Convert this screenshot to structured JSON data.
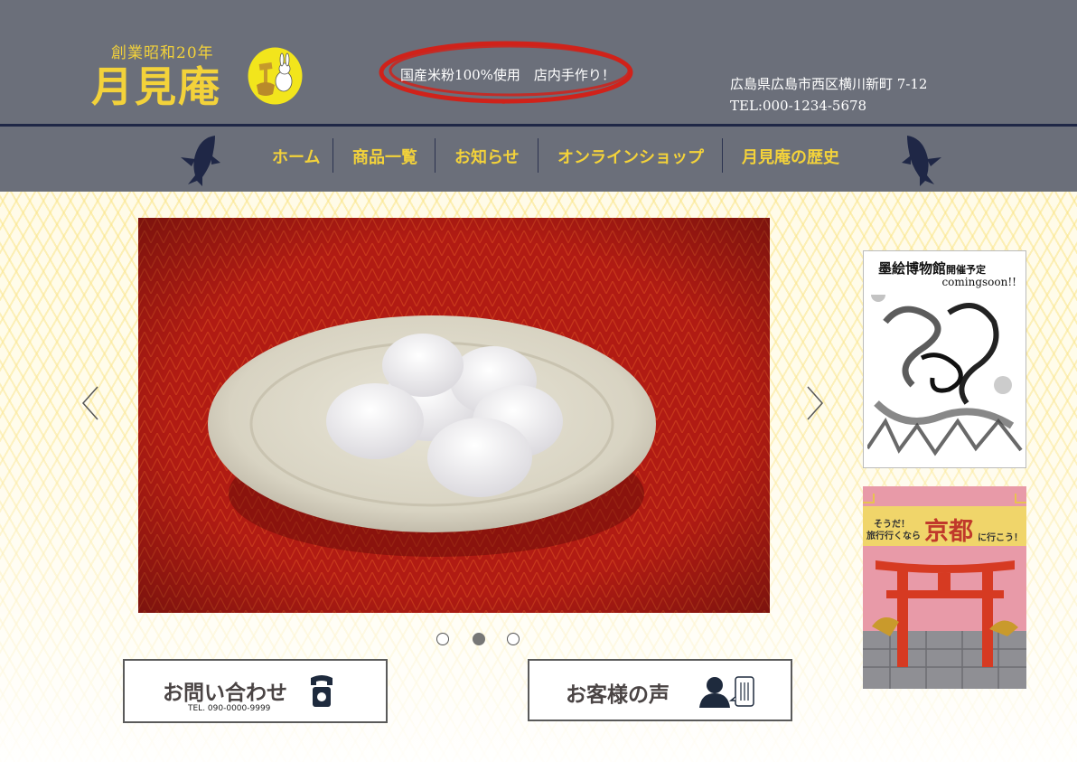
{
  "brand": {
    "since": "創業昭和20年",
    "name": "月見庵",
    "logo_icon": "rabbit-mochi-pounding-icon"
  },
  "tagline": "国産米粉100%使用　店内手作り！",
  "address": {
    "line1": "広島県広島市西区横川新町 7-12",
    "tel": "TEL:000-1234-5678"
  },
  "nav": {
    "items": [
      {
        "label": "ホーム"
      },
      {
        "label": "商品一覧"
      },
      {
        "label": "お知らせ"
      },
      {
        "label": "オンラインショップ"
      },
      {
        "label": "月見庵の歴史"
      }
    ]
  },
  "slider": {
    "image": "daifuku-plate-photo",
    "prev_icon": "chevron-left-icon",
    "next_icon": "chevron-right-icon",
    "slide_count": 3,
    "active_index": 2
  },
  "contact_button": {
    "label": "お問い合わせ",
    "tel": "TEL. 090-0000-9999",
    "icon": "telephone-icon"
  },
  "voice_button": {
    "label": "お客様の声",
    "icon": "person-speech-icon"
  },
  "banners": {
    "museum": {
      "title": "墨絵博物館",
      "subtitle": "開催予定",
      "note": "comingsoon!!"
    },
    "kyoto": {
      "line1": "そうだ！",
      "line2": "旅行行くなら",
      "city": "京都",
      "line3": "に行こう！"
    }
  },
  "colors": {
    "header_bg": "#6b6f7a",
    "accent_yellow": "#f3d23a",
    "navy": "#1f2746"
  }
}
